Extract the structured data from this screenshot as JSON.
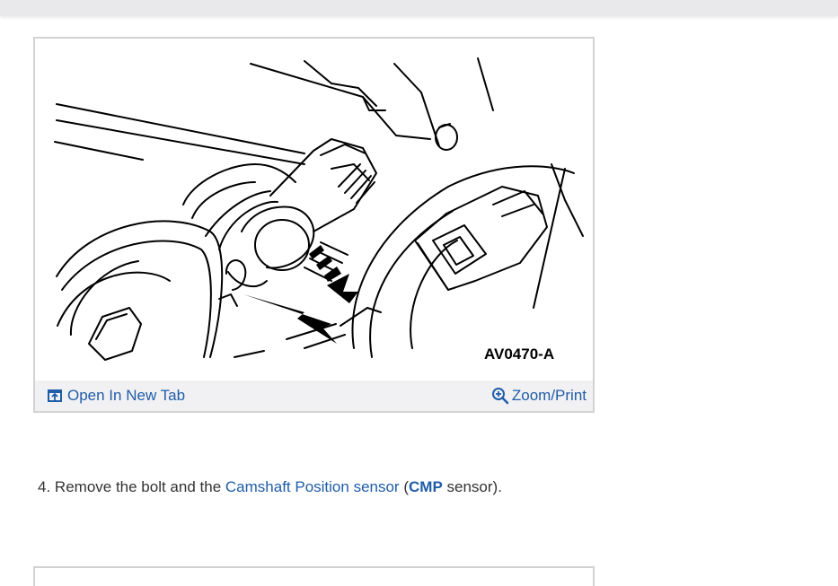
{
  "figure": {
    "image_label": "AV0470-A",
    "open_new_tab_label": "Open In New Tab",
    "zoom_print_label": "Zoom/Print"
  },
  "step": {
    "number": "4.",
    "text_before": "Remove the bolt and the",
    "link_text": "Camshaft Position sensor",
    "paren_open": "(",
    "abbr": "CMP",
    "text_after": "sensor)."
  },
  "colors": {
    "link": "#1f5da8",
    "toolbar_bg": "#f1f1f4",
    "card_border": "#d2d2d2",
    "top_bar": "#e9e9ec"
  },
  "icons": {
    "open_new_tab": "open-new-tab-icon",
    "zoom": "zoom-in-icon"
  }
}
